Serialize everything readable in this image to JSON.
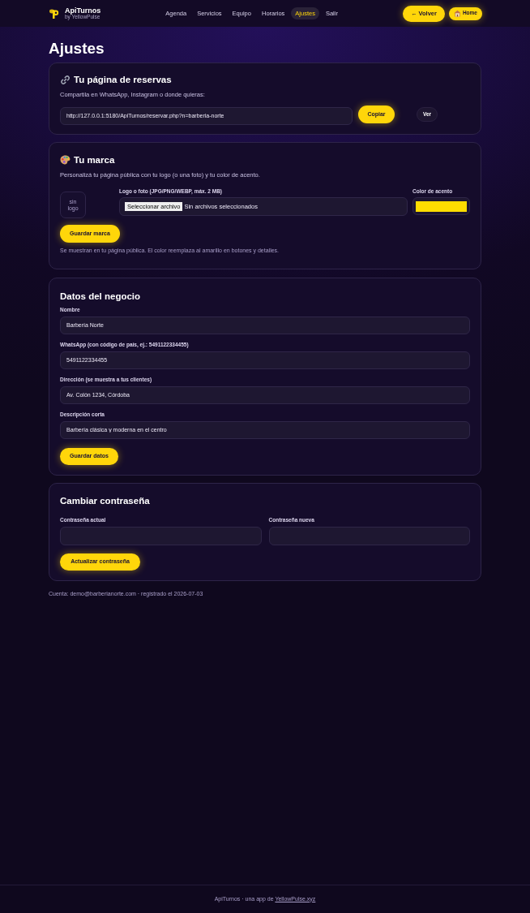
{
  "header": {
    "brand": {
      "name": "ApiTurnos",
      "tagline": "by YellowPulse"
    },
    "nav": [
      {
        "label": "Agenda",
        "selected": false
      },
      {
        "label": "Servicios",
        "selected": false
      },
      {
        "label": "Equipo",
        "selected": false
      },
      {
        "label": "Horarios",
        "selected": false
      },
      {
        "label": "Ajustes",
        "selected": true
      },
      {
        "label": "Salir",
        "selected": false
      }
    ],
    "actions": [
      {
        "label": "← Volver",
        "kind": "back"
      },
      {
        "label": "Home",
        "kind": "home"
      }
    ]
  },
  "page_title": "Ajustes",
  "booking_card": {
    "title": "Tu página de reservas",
    "description": "Compartila en WhatsApp, Instagram o donde quieras:",
    "url": "http://127.0.0.1:5180/ApiTurnos/reservar.php?n=barberia-norte",
    "buttons": [
      {
        "label": "Copiar",
        "kind": "primary"
      },
      {
        "label": "Ver",
        "kind": "secondary"
      }
    ]
  },
  "brand_card": {
    "title": "Tu marca",
    "description": "Personalizá tu página pública con tu logo (o una foto) y tu color de acento.",
    "logo_placeholder": "sin logo",
    "file_field": {
      "label": "Logo o foto (JPG/PNG/WEBP, máx. 2 MB)",
      "button": "Seleccionar archivo",
      "status": "Sin archivos seleccionados"
    },
    "accent": {
      "label": "Color de acento",
      "color": "#ffdd00"
    },
    "save_button": "Guardar marca",
    "note": "Se muestran en tu página pública. El color reemplaza al amarillo en botones y detalles."
  },
  "business_card": {
    "title": "Datos del negocio",
    "fields": [
      {
        "label": "Nombre",
        "value": "Barbería Norte"
      },
      {
        "label": "WhatsApp (con código de país, ej.: 5491122334455)",
        "value": "5491122334455"
      },
      {
        "label": "Dirección (se muestra a tus clientes)",
        "value": "Av. Colón 1234, Córdoba"
      },
      {
        "label": "Descripción corta",
        "value": "Barbería clásica y moderna en el centro"
      }
    ],
    "save_button": "Guardar datos"
  },
  "password_card": {
    "title": "Cambiar contraseña",
    "fields": [
      {
        "label": "Contraseña actual"
      },
      {
        "label": "Contraseña nueva"
      }
    ],
    "submit_button": "Actualizar contraseña"
  },
  "account_info": "Cuenta: demo@barberianorte.com · registrado el 2026-07-03",
  "footer": {
    "text": "ApiTurnos · una app de",
    "link": "YellowPulse.xyz"
  }
}
